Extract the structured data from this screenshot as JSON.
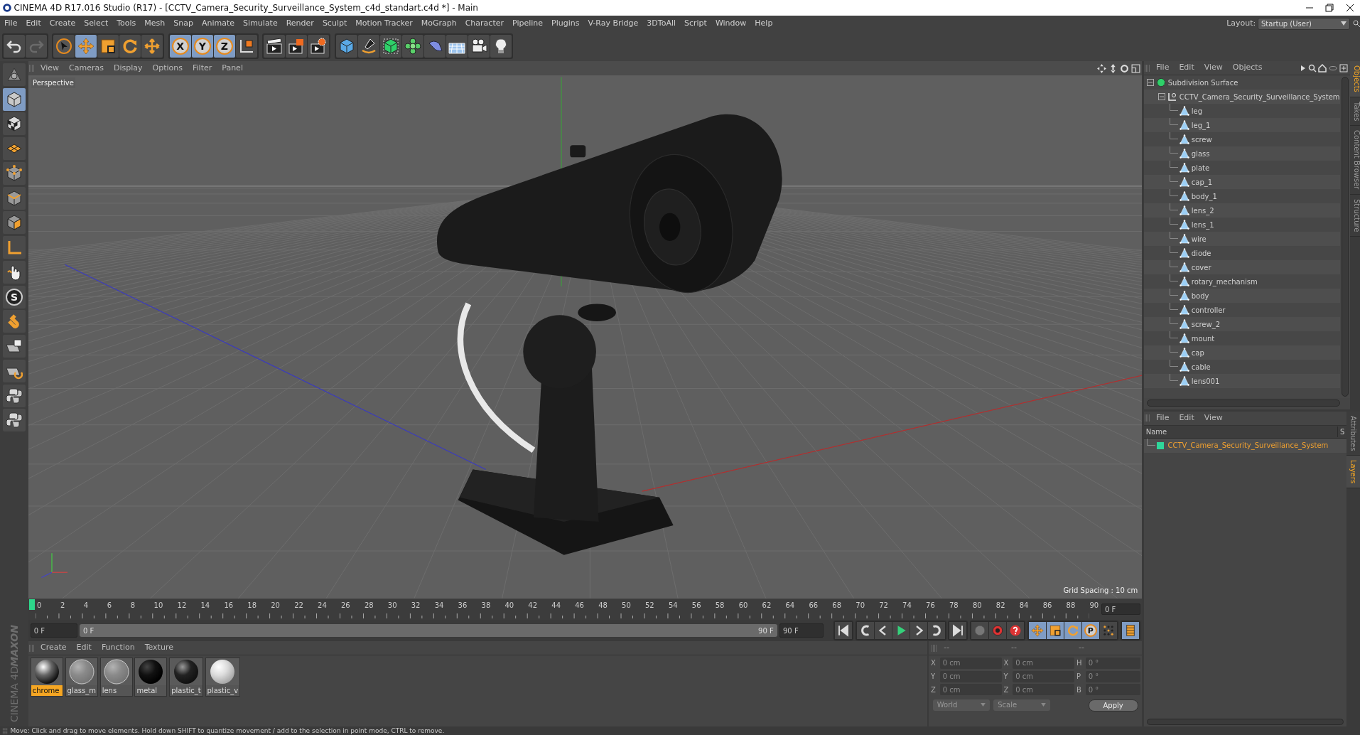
{
  "window": {
    "title": "CINEMA 4D R17.016 Studio (R17) - [CCTV_Camera_Security_Surveillance_System_c4d_standart.c4d *] - Main"
  },
  "menu": [
    "File",
    "Edit",
    "Create",
    "Select",
    "Tools",
    "Mesh",
    "Snap",
    "Animate",
    "Simulate",
    "Render",
    "Sculpt",
    "Motion Tracker",
    "MoGraph",
    "Character",
    "Pipeline",
    "Plugins",
    "V-Ray Bridge",
    "3DToAll",
    "Script",
    "Window",
    "Help"
  ],
  "layout": {
    "label": "Layout:",
    "value": "Startup (User)"
  },
  "toolbar": [
    {
      "kind": "undo",
      "selected": false
    },
    {
      "kind": "redo",
      "selected": false
    },
    {
      "kind": "cursor",
      "selected": false
    },
    {
      "kind": "move",
      "selected": true
    },
    {
      "kind": "scale",
      "selected": false
    },
    {
      "kind": "rotate",
      "selected": false
    },
    {
      "kind": "place",
      "selected": false
    },
    {
      "kind": "axis",
      "label": "X",
      "selected": true
    },
    {
      "kind": "axis",
      "label": "Y",
      "selected": true
    },
    {
      "kind": "axis",
      "label": "Z",
      "selected": true
    },
    {
      "kind": "coords",
      "selected": false
    },
    {
      "kind": "renderview",
      "selected": false
    },
    {
      "kind": "renderpic",
      "selected": false
    },
    {
      "kind": "rendersettings",
      "selected": false
    },
    {
      "kind": "cube",
      "selected": false
    },
    {
      "kind": "pen",
      "selected": false
    },
    {
      "kind": "subdivision",
      "selected": false
    },
    {
      "kind": "array",
      "selected": false
    },
    {
      "kind": "bend",
      "selected": false
    },
    {
      "kind": "floor",
      "selected": false
    },
    {
      "kind": "camera",
      "selected": false
    },
    {
      "kind": "light",
      "selected": false
    }
  ],
  "left_toolbar": [
    {
      "kind": "model",
      "selected": false
    },
    {
      "kind": "object",
      "selected": true
    },
    {
      "kind": "texture",
      "selected": false
    },
    {
      "kind": "workplane",
      "selected": false
    },
    {
      "kind": "points",
      "selected": false
    },
    {
      "kind": "edges",
      "selected": false
    },
    {
      "kind": "polygons",
      "selected": false
    },
    {
      "kind": "axis",
      "selected": false
    },
    {
      "kind": "tweak",
      "selected": false
    },
    {
      "kind": "snap",
      "label": "S",
      "selected": false
    },
    {
      "kind": "magnet",
      "selected": false
    },
    {
      "kind": "lockgrid",
      "selected": false
    },
    {
      "kind": "gridsnap",
      "selected": false
    },
    {
      "kind": "python",
      "selected": false
    },
    {
      "kind": "python",
      "selected": false
    }
  ],
  "viewport": {
    "menu": [
      "View",
      "Cameras",
      "Display",
      "Options",
      "Filter",
      "Panel"
    ],
    "camera_label": "Perspective",
    "grid_spacing": "Grid Spacing : 10 cm"
  },
  "timeline": {
    "ticks": [
      "0",
      "2",
      "4",
      "6",
      "8",
      "10",
      "12",
      "14",
      "16",
      "18",
      "20",
      "22",
      "24",
      "26",
      "28",
      "30",
      "32",
      "34",
      "36",
      "38",
      "40",
      "42",
      "44",
      "46",
      "48",
      "50",
      "52",
      "54",
      "56",
      "58",
      "60",
      "62",
      "64",
      "66",
      "68",
      "70",
      "72",
      "74",
      "76",
      "78",
      "80",
      "82",
      "84",
      "86",
      "88",
      "90"
    ],
    "current_frame": "0 F",
    "start_field": "0 F",
    "range": {
      "start": "0 F",
      "end": "90 F",
      "level": 1
    },
    "end_field": "90 F",
    "key_tools": [
      {
        "kind": "move",
        "selected": true
      },
      {
        "kind": "scale",
        "selected": true
      },
      {
        "kind": "rotate",
        "selected": true
      },
      {
        "kind": "param",
        "label": "P",
        "selected": true
      },
      {
        "kind": "grid",
        "selected": false
      }
    ]
  },
  "materials": {
    "menu": [
      "Create",
      "Edit",
      "Function",
      "Texture"
    ],
    "items": [
      {
        "name": "chrome",
        "kind": "chrome",
        "selected": true
      },
      {
        "name": "glass_m",
        "kind": "glass",
        "selected": false
      },
      {
        "name": "lens",
        "kind": "glass",
        "selected": false
      },
      {
        "name": "metal",
        "kind": "matte",
        "selected": false
      },
      {
        "name": "plastic_t",
        "kind": "glossy",
        "selected": false
      },
      {
        "name": "plastic_v",
        "kind": "white",
        "selected": false
      }
    ]
  },
  "logo": {
    "brand": "MAXON",
    "product": "CINEMA 4D"
  },
  "coordinates": {
    "headers": [
      "--",
      "--",
      "--"
    ],
    "columns": [
      [
        {
          "label": "X",
          "value": "0 cm"
        },
        {
          "label": "Y",
          "value": "0 cm"
        },
        {
          "label": "Z",
          "value": "0 cm"
        }
      ],
      [
        {
          "label": "X",
          "value": "0 cm"
        },
        {
          "label": "Y",
          "value": "0 cm"
        },
        {
          "label": "Z",
          "value": "0 cm"
        }
      ],
      [
        {
          "label": "H",
          "value": "0 °"
        },
        {
          "label": "P",
          "value": "0 °"
        },
        {
          "label": "B",
          "value": "0 °"
        }
      ]
    ],
    "dropdowns": [
      "World",
      "Scale"
    ],
    "apply": "Apply"
  },
  "objects": {
    "menu": [
      "File",
      "Edit",
      "View",
      "Objects"
    ],
    "tree": [
      {
        "name": "Subdivision Surface",
        "kind": "subdivision",
        "expanded": true,
        "children": [
          {
            "name": "CCTV_Camera_Security_Surveillance_System",
            "kind": "null",
            "expanded": true,
            "children": [
              {
                "name": "leg",
                "kind": "polygon"
              },
              {
                "name": "leg_1",
                "kind": "polygon"
              },
              {
                "name": "screw",
                "kind": "polygon"
              },
              {
                "name": "glass",
                "kind": "polygon"
              },
              {
                "name": "plate",
                "kind": "polygon"
              },
              {
                "name": "cap_1",
                "kind": "polygon"
              },
              {
                "name": "body_1",
                "kind": "polygon"
              },
              {
                "name": "lens_2",
                "kind": "polygon"
              },
              {
                "name": "lens_1",
                "kind": "polygon"
              },
              {
                "name": "wire",
                "kind": "polygon"
              },
              {
                "name": "diode",
                "kind": "polygon"
              },
              {
                "name": "cover",
                "kind": "polygon"
              },
              {
                "name": "rotary_mechanism",
                "kind": "polygon"
              },
              {
                "name": "body",
                "kind": "polygon"
              },
              {
                "name": "controller",
                "kind": "polygon"
              },
              {
                "name": "screw_2",
                "kind": "polygon"
              },
              {
                "name": "mount",
                "kind": "polygon"
              },
              {
                "name": "cap",
                "kind": "polygon"
              },
              {
                "name": "cable",
                "kind": "polygon"
              },
              {
                "name": "lens001",
                "kind": "polygon"
              }
            ]
          }
        ]
      }
    ]
  },
  "side_tabs_top": [
    {
      "label": "Objects",
      "selected": true
    },
    {
      "label": "Takes",
      "selected": false
    },
    {
      "label": "Content Browser",
      "selected": false
    },
    {
      "label": "Structure",
      "selected": false
    }
  ],
  "layers": {
    "menu": [
      "File",
      "Edit",
      "View"
    ],
    "columns": [
      "Name",
      "S"
    ],
    "rows": [
      {
        "name": "CCTV_Camera_Security_Surveillance_System",
        "color": "#2fd69a"
      }
    ]
  },
  "side_tabs_bottom": [
    {
      "label": "Attributes",
      "selected": false
    },
    {
      "label": "Layers",
      "selected": true
    }
  ],
  "status_bar": "Move: Click and drag to move elements. Hold down SHIFT to quantize movement / add to the selection in point mode, CTRL to remove."
}
